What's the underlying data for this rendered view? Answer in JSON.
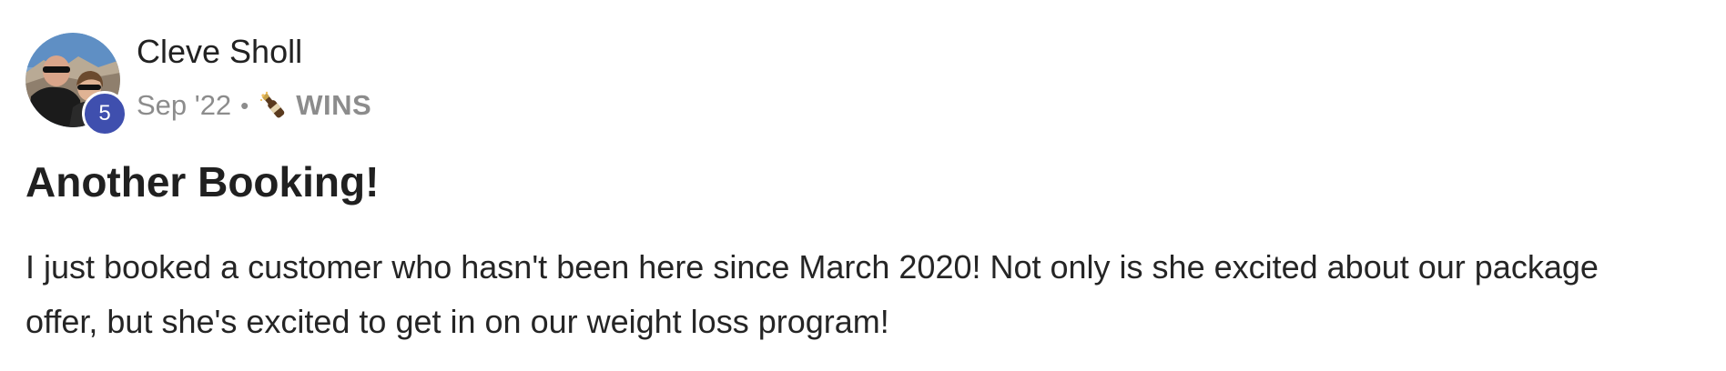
{
  "post": {
    "author": {
      "name": "Cleve Sholl",
      "level": "5"
    },
    "date": "Sep '22",
    "separator": "•",
    "category": {
      "icon": "champagne-bottle-icon",
      "label": "WINS"
    },
    "title": "Another Booking!",
    "body": "I just booked a customer who hasn't been here since March 2020! Not only is she excited about our package offer, but she's excited to get in on our weight loss program!"
  },
  "colors": {
    "level_badge": "#3f4fae",
    "meta_text": "#8c8c8c",
    "title_text": "#202020",
    "body_text": "#252525"
  }
}
